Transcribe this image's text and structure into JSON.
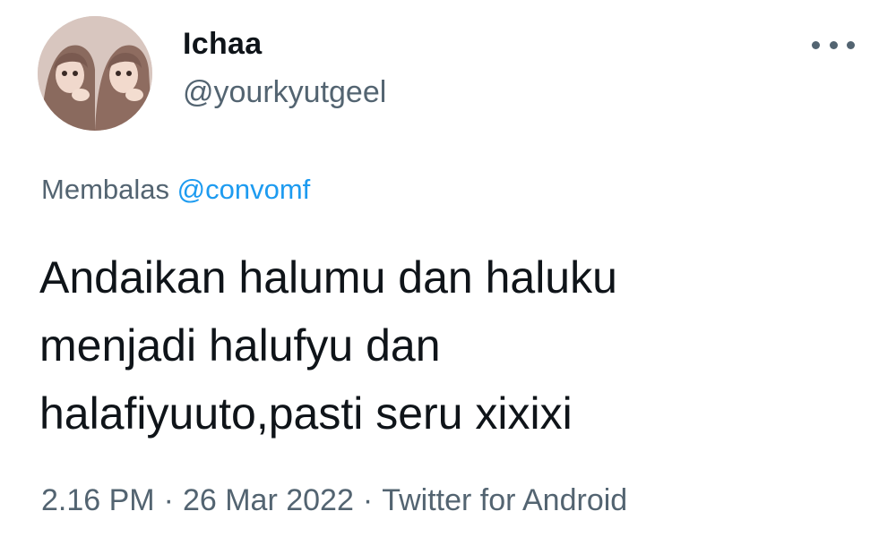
{
  "user": {
    "display_name": "Ichaa",
    "handle": "@yourkyutgeel"
  },
  "menu": {
    "icon": "more-horizontal-icon"
  },
  "reply": {
    "prefix": "Membalas",
    "mention": "@convomf"
  },
  "tweet": {
    "lines": [
      "Andaikan halumu dan haluku",
      "menjadi halufyu dan",
      "halafiyuuto,pasti seru xixixi"
    ]
  },
  "meta": {
    "time": "2.16 PM",
    "separator": "·",
    "date": "26 Mar 2022",
    "source": "Twitter for Android"
  },
  "colors": {
    "text": "#0f1419",
    "secondary": "#536471",
    "link": "#1d9bf0"
  }
}
